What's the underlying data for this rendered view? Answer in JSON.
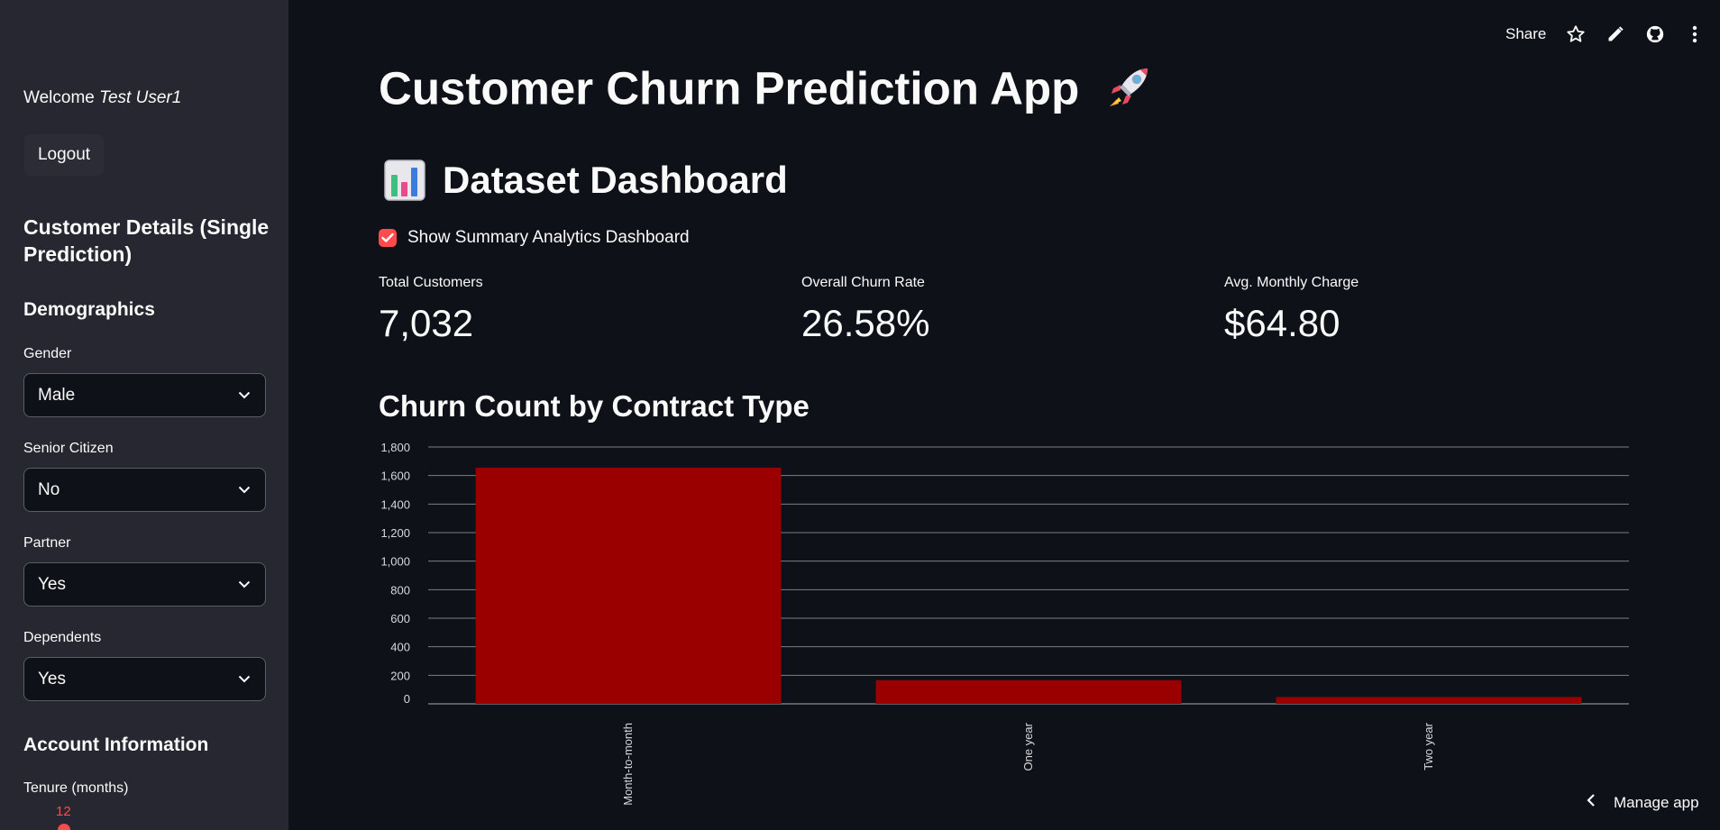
{
  "sidebar": {
    "welcome_prefix": "Welcome",
    "user_name": "Test User1",
    "logout_label": "Logout",
    "section_title": "Customer Details (Single Prediction)",
    "demographics_title": "Demographics",
    "fields": [
      {
        "label": "Gender",
        "value": "Male"
      },
      {
        "label": "Senior Citizen",
        "value": "No"
      },
      {
        "label": "Partner",
        "value": "Yes"
      },
      {
        "label": "Dependents",
        "value": "Yes"
      }
    ],
    "account_title": "Account Information",
    "tenure_label": "Tenure (months)",
    "tenure_value": "12"
  },
  "header": {
    "share_label": "Share"
  },
  "main": {
    "title": "Customer Churn Prediction App",
    "subtitle": "Dataset Dashboard",
    "checkbox_label": "Show Summary Analytics Dashboard",
    "metrics": [
      {
        "label": "Total Customers",
        "value": "7,032"
      },
      {
        "label": "Overall Churn Rate",
        "value": "26.58%"
      },
      {
        "label": "Avg. Monthly Charge",
        "value": "$64.80"
      }
    ],
    "chart_title": "Churn Count by Contract Type"
  },
  "manage_label": "Manage app",
  "colors": {
    "accent": "#ff4b4b",
    "bar": "#9b0000",
    "background": "#0e1117",
    "sidebar": "#262730"
  },
  "chart_data": {
    "type": "bar",
    "title": "Churn Count by Contract Type",
    "categories": [
      "Month-to-month",
      "One year",
      "Two year"
    ],
    "values": [
      1655,
      166,
      48
    ],
    "ylim": [
      0,
      1800
    ],
    "yticks": [
      0,
      200,
      400,
      600,
      800,
      1000,
      1200,
      1400,
      1600,
      1800
    ],
    "ytick_labels": [
      "0",
      "200",
      "400",
      "600",
      "800",
      "1,000",
      "1,200",
      "1,400",
      "1,600",
      "1,800"
    ],
    "xlabel": "",
    "ylabel": "",
    "grid": true
  }
}
